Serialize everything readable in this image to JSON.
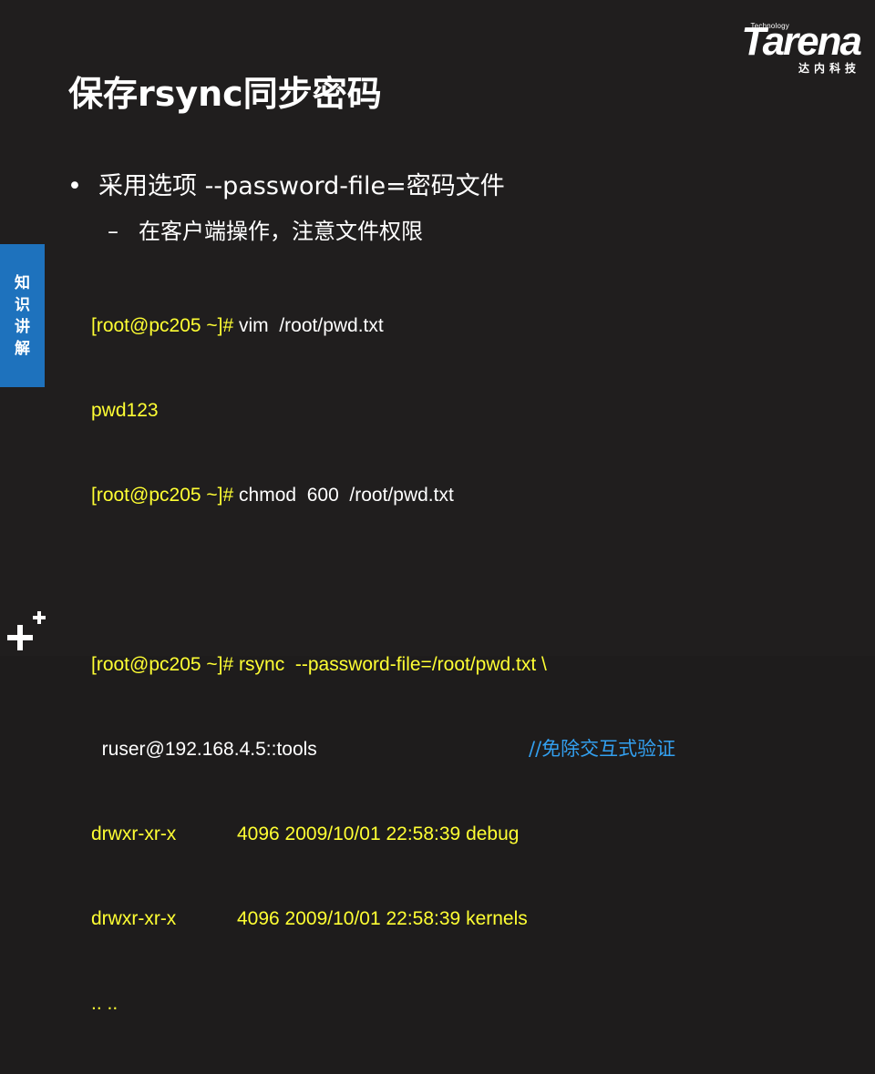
{
  "logo": {
    "tech": "Technology",
    "word": "Tarena",
    "cn": "达内科技"
  },
  "title": "保存rsync同步密码",
  "bullets": {
    "level1": "采用选项  --password-file=密码文件",
    "level2": "在客户端操作，注意文件权限"
  },
  "side_tab": [
    "知",
    "识",
    "讲",
    "解"
  ],
  "code": {
    "line1_prompt": "[root@pc205 ~]# ",
    "line1_cmd": "vim  /root/pwd.txt",
    "line2": "pwd123",
    "line3_prompt": "[root@pc205 ~]# ",
    "line3_cmd": "chmod  600  /root/pwd.txt",
    "line5_prompt": "[root@pc205 ~]# ",
    "line5_cmd": "rsync  --password-file=/root/pwd.txt \\",
    "line6": "  ruser@192.168.4.5::tools",
    "line6_comment": "//免除交互式验证",
    "line7_a": "drwxr-xr-x",
    "line7_b": "4096 2009/10/01 22:58:39 debug",
    "line8_a": "drwxr-xr-x",
    "line8_b": "4096 2009/10/01 22:58:39 kernels",
    "line9": ".. .."
  },
  "colors": {
    "background": "#201e1e",
    "code_yellow": "#ffff33",
    "comment_blue": "#33a0f0",
    "tab_blue": "#1e72bd"
  }
}
